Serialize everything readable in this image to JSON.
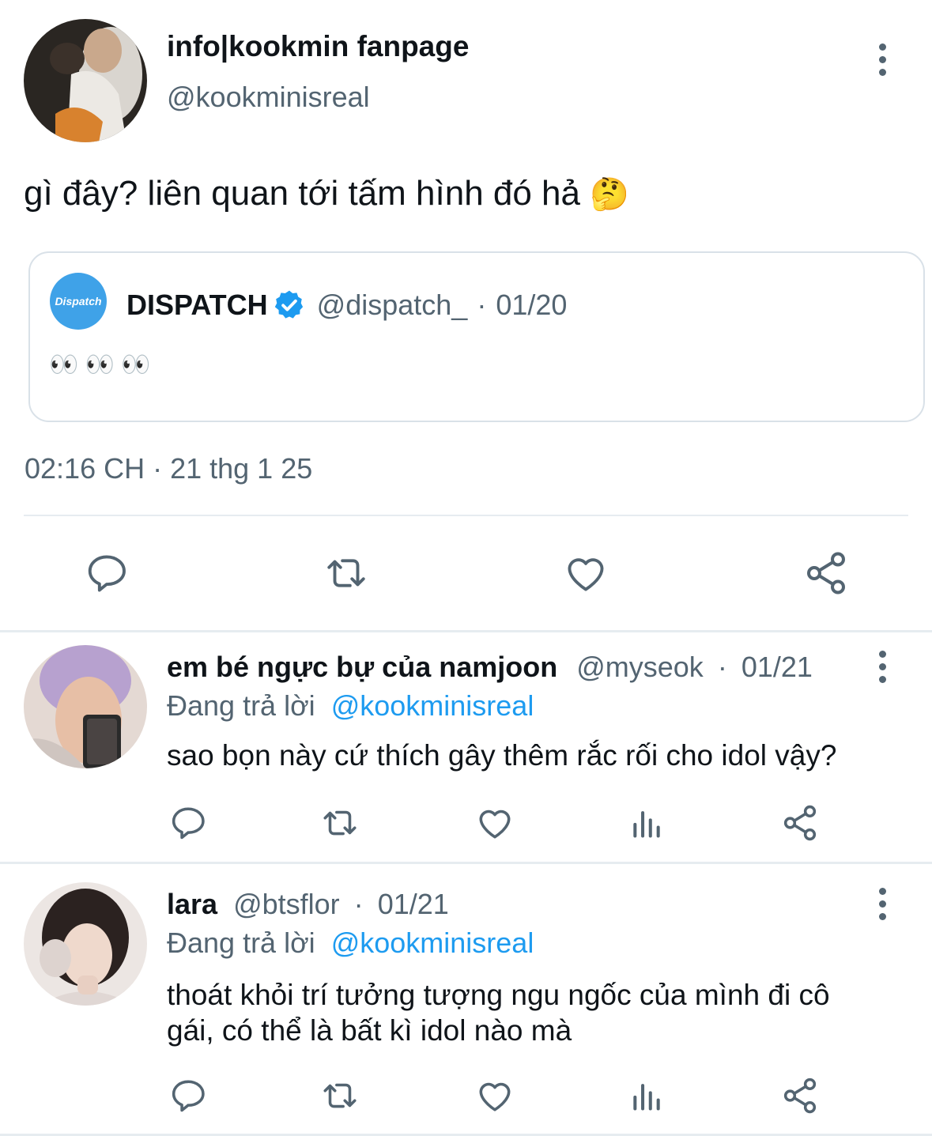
{
  "main_tweet": {
    "display_name": "info|kookmin fanpage",
    "handle": "@kookminisreal",
    "text": "gì đây? liên quan tới tấm hình đó hả",
    "emoji": "🤔",
    "timestamp": "02:16 CH · 21 thg 1 25",
    "quoted": {
      "avatar_text": "Dispatch",
      "display_name": "DISPATCH",
      "handle": "@dispatch_",
      "separator": "·",
      "date": "01/20",
      "text": "👀 👀 👀"
    }
  },
  "replies": [
    {
      "display_name": "em bé ngực bự của namjoon",
      "handle": "@myseok",
      "separator": "·",
      "date": "01/21",
      "replying_prefix": "Đang trả lời",
      "replying_to": "@kookminisreal",
      "text": "sao bọn này cứ thích gây thêm rắc rối cho idol vậy?"
    },
    {
      "display_name": "lara",
      "handle": "@btsflor",
      "separator": "·",
      "date": "01/21",
      "replying_prefix": "Đang trả lời",
      "replying_to": "@kookminisreal",
      "text_line1": "thoát khỏi trí tưởng tượng ngu ngốc của mình đi cô",
      "text_line2": "gái, có thể là bất kì idol nào mà"
    }
  ],
  "colors": {
    "accent": "#1d9bf0",
    "muted": "#536471",
    "divider": "#e6ecf0"
  },
  "icons": [
    "reply-icon",
    "retweet-icon",
    "like-icon",
    "views-icon",
    "share-icon",
    "more-icon",
    "verified-badge-icon"
  ]
}
